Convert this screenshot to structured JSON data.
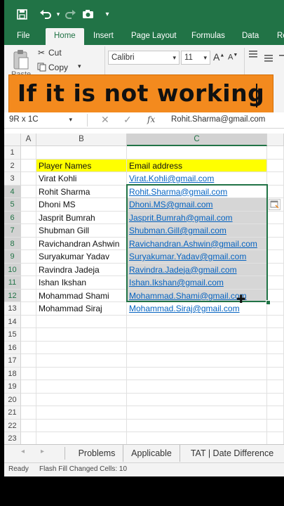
{
  "ribbon": {
    "tabs": [
      "File",
      "Home",
      "Insert",
      "Page Layout",
      "Formulas",
      "Data",
      "Re"
    ],
    "clipboard": {
      "cut": "Cut",
      "copy": "Copy",
      "paste": "Paste"
    },
    "font": {
      "name": "Calibri",
      "size": "11"
    },
    "increase_font": "A",
    "decrease_font": "A"
  },
  "banner": {
    "text": "If it is not working"
  },
  "formula_bar": {
    "name_box": "9R x 1C",
    "fx": "fx",
    "content": "Rohit.Sharma@gmail.com"
  },
  "grid": {
    "columns": [
      "A",
      "B",
      "C"
    ],
    "rows": [
      {
        "n": "1",
        "b": "",
        "c": ""
      },
      {
        "n": "2",
        "b": "Player Names",
        "c": "Email address"
      },
      {
        "n": "3",
        "b": "Virat Kohli",
        "c": "Virat.Kohli@gmail.com"
      },
      {
        "n": "4",
        "b": "Rohit Sharma",
        "c": "Rohit.Sharma@gmail.com"
      },
      {
        "n": "5",
        "b": "Dhoni MS",
        "c": "Dhoni.MS@gmail.com"
      },
      {
        "n": "6",
        "b": "Jasprit Bumrah",
        "c": "Jasprit.Bumrah@gmail.com"
      },
      {
        "n": "7",
        "b": "Shubman Gill",
        "c": "Shubman.Gill@gmail.com"
      },
      {
        "n": "8",
        "b": "Ravichandran Ashwin",
        "c": "Ravichandran.Ashwin@gmail.com"
      },
      {
        "n": "9",
        "b": "Suryakumar Yadav",
        "c": "Suryakumar.Yadav@gmail.com"
      },
      {
        "n": "10",
        "b": "Ravindra Jadeja",
        "c": "Ravindra.Jadeja@gmail.com"
      },
      {
        "n": "11",
        "b": "Ishan Ikshan",
        "c": "Ishan.Ikshan@gmail.com"
      },
      {
        "n": "12",
        "b": "Mohammad Shami",
        "c": "Mohammad.Shami@gmail.com"
      },
      {
        "n": "13",
        "b": "Mohammad Siraj",
        "c": "Mohammad.Siraj@gmail.com"
      },
      {
        "n": "14",
        "b": "",
        "c": ""
      },
      {
        "n": "15",
        "b": "",
        "c": ""
      },
      {
        "n": "16",
        "b": "",
        "c": ""
      },
      {
        "n": "17",
        "b": "",
        "c": ""
      },
      {
        "n": "18",
        "b": "",
        "c": ""
      },
      {
        "n": "19",
        "b": "",
        "c": ""
      },
      {
        "n": "20",
        "b": "",
        "c": ""
      },
      {
        "n": "21",
        "b": "",
        "c": ""
      },
      {
        "n": "22",
        "b": "",
        "c": ""
      },
      {
        "n": "23",
        "b": "",
        "c": ""
      }
    ]
  },
  "sheets": [
    "Problems",
    "Applicable",
    "TAT | Date Difference"
  ],
  "status": {
    "mode": "Ready",
    "message": "Flash Fill Changed Cells: 10"
  },
  "colors": {
    "excel_green": "#217346",
    "banner": "#f38a1e",
    "header_fill": "#ffff00",
    "link": "#0563c1"
  }
}
